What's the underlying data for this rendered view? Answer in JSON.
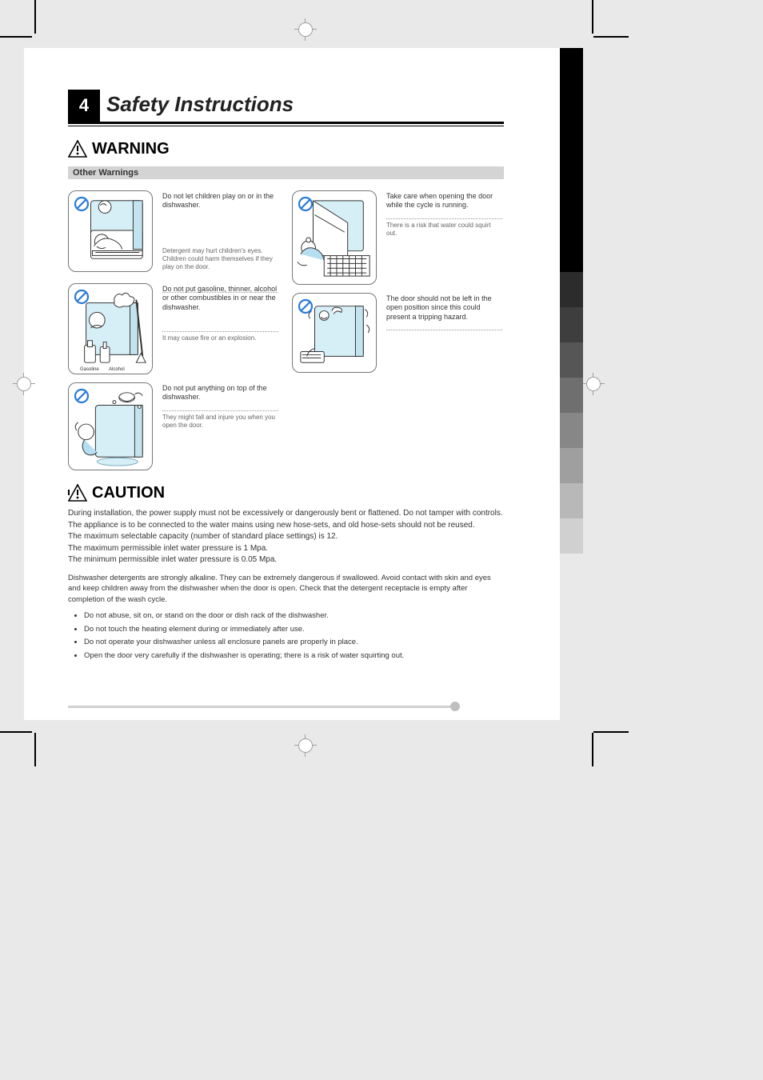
{
  "page_number": "4",
  "section_title": "Safety Instructions",
  "warning_label": "WARNING",
  "other_warnings_header": "Other Warnings",
  "caution_label": "CAUTION",
  "illustrations": [
    {
      "caption": "Do not let children play on or in the dishwasher.",
      "reason": "Detergent may hurt children's eyes. Children could harm themselves if they play on the door."
    },
    {
      "caption": "Do not put gasoline, thinner, alcohol or other combustibles in or near the dishwasher.",
      "reason": "It may cause fire or an explosion."
    },
    {
      "caption": "Do not put anything on top of the dishwasher.",
      "reason": "They might fall and injure you when you open the door."
    },
    {
      "caption": "Take care when opening the door while the cycle is running.",
      "reason": "There is a risk that water could squirt out."
    },
    {
      "caption": "The door should not be left in the open position since this could present a tripping hazard."
    }
  ],
  "caution_paragraphs": [
    "During installation, the power supply must not be excessively or dangerously bent or flattened. Do not tamper with controls.",
    "The appliance is to be connected to the water mains using new hose-sets, and old hose-sets should not be reused.",
    "The maximum selectable capacity (number of standard place settings) is 12.",
    "The maximum permissible inlet water pressure is 1 Mpa.",
    "The minimum permissible inlet water pressure is 0.05 Mpa."
  ],
  "caution_pre": "Dishwasher detergents are strongly alkaline. They can be extremely dangerous if swallowed. Avoid contact with skin and eyes and keep children away from the dishwasher when the door is open. Check that the detergent receptacle is empty after completion of the wash cycle.",
  "caution_list": [
    "Do not abuse, sit on, or stand on the door or dish rack of the dishwasher.",
    "Do not touch the heating element during or immediately after use.",
    "Do not operate your dishwasher unless all enclosure panels are properly in place.",
    "Open the door very carefully if the dishwasher is operating; there is a risk of water squirting out."
  ],
  "thumb_tab_colors": [
    "#000000",
    "#000000",
    "#000000",
    "#3d3d3d",
    "#4a4a4a",
    "#5a5a5a",
    "#6b6b6b",
    "#7c7c7c",
    "#8e8e8e",
    "#a0a0a0",
    "#b3b3b3"
  ],
  "labels_in_art": {
    "gasoline": "Gasoline",
    "alcohol": "Alcohol"
  }
}
